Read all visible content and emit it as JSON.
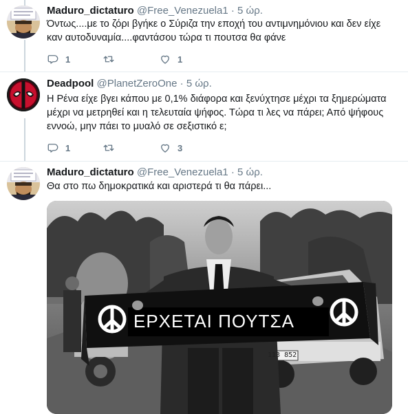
{
  "colors": {
    "name": "#14171a",
    "secondary": "#657786",
    "thread_line": "#ccd6dd",
    "divider": "#e6ecf0"
  },
  "tweets": [
    {
      "display_name": "Maduro_dictaturo",
      "handle": "@Free_Venezuela1",
      "separator": "·",
      "time": "5 ώρ.",
      "text": "Όντως....με το ζόρι βγήκε ο Σύριζα την εποχή του αντιμνημόνιου και δεν είχε καν αυτοδυναμία....φαντάσου τώρα τι πουτσα θα φάνε",
      "reply_count": "1",
      "retweet_count": "",
      "like_count": "1"
    },
    {
      "display_name": "Deadpool",
      "handle": "@PlanetZeroOne",
      "separator": "·",
      "time": "5 ώρ.",
      "text": "Η Ρένα είχε βγει κάπου με 0,1% διάφορα και ξενύχτησε μέχρι τα ξημερώματα μέχρι να μετρηθεί και η τελευταία ψήφος. Τώρα τι λες να πάρει; Από ψήφους εννοώ, μην πάει το μυαλό σε σεξιστικό ε;",
      "reply_count": "1",
      "retweet_count": "",
      "like_count": "3"
    },
    {
      "display_name": "Maduro_dictaturo",
      "handle": "@Free_Venezuela1",
      "separator": "·",
      "time": "5 ώρ.",
      "text": "Θα στο πω δημοκρατικά και αριστερά τι θα πάρει...",
      "media": {
        "banner_text": "ΕΡΧΕΤΑΙ ΠΟΥΤΣΑ",
        "plate_text": "113 852"
      }
    }
  ],
  "icons": {
    "reply": "reply-icon",
    "retweet": "retweet-icon",
    "like": "like-icon"
  }
}
